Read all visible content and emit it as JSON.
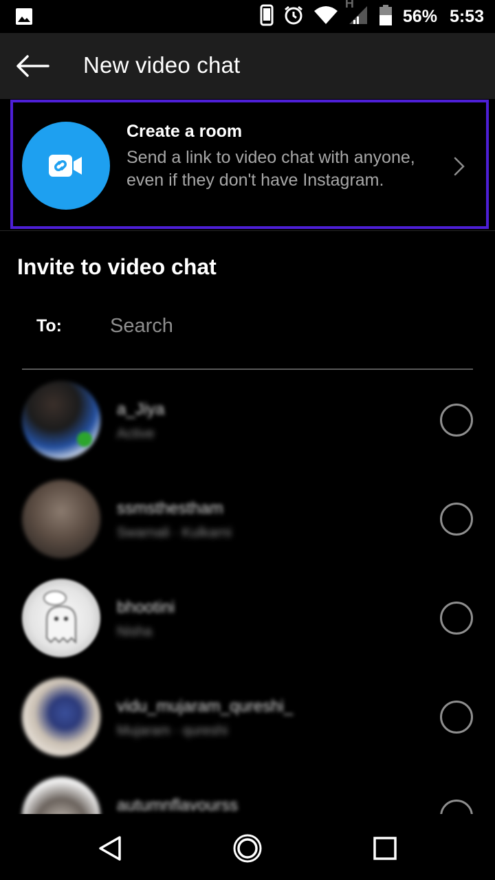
{
  "status_bar": {
    "battery_percent": "56%",
    "time": "5:53",
    "network_type": "H",
    "icons": [
      "image-icon",
      "phone-icon",
      "alarm-icon",
      "wifi-icon",
      "signal-icon",
      "battery-icon"
    ]
  },
  "app_bar": {
    "title": "New video chat",
    "back_icon": "arrow-left-icon"
  },
  "create_room": {
    "title": "Create a room",
    "description": "Send a link to video chat with anyone, even if they don't have Instagram.",
    "icon": "link-video-icon",
    "chevron_icon": "chevron-right-icon",
    "colors": {
      "avatar_bg": "#1ea0f0",
      "highlight_border": "#4d1fd6"
    }
  },
  "invite": {
    "title": "Invite to video chat",
    "to_label": "To:",
    "search_placeholder": "Search"
  },
  "contacts": [
    {
      "name": "a_Jiya",
      "sub": "Active",
      "online": true
    },
    {
      "name": "ssmsthestham",
      "sub": "Swarnali · Kulkarni",
      "online": false
    },
    {
      "name": "bhootini",
      "sub": "Nisha",
      "online": false
    },
    {
      "name": "vidu_mujaram_qureshi_",
      "sub": "Mujaram · qureshi",
      "online": false
    },
    {
      "name": "autumnflavourss",
      "sub": "",
      "online": false
    }
  ],
  "nav_bar": {
    "icons": [
      "back-triangle-icon",
      "home-circle-icon",
      "recents-square-icon"
    ]
  }
}
